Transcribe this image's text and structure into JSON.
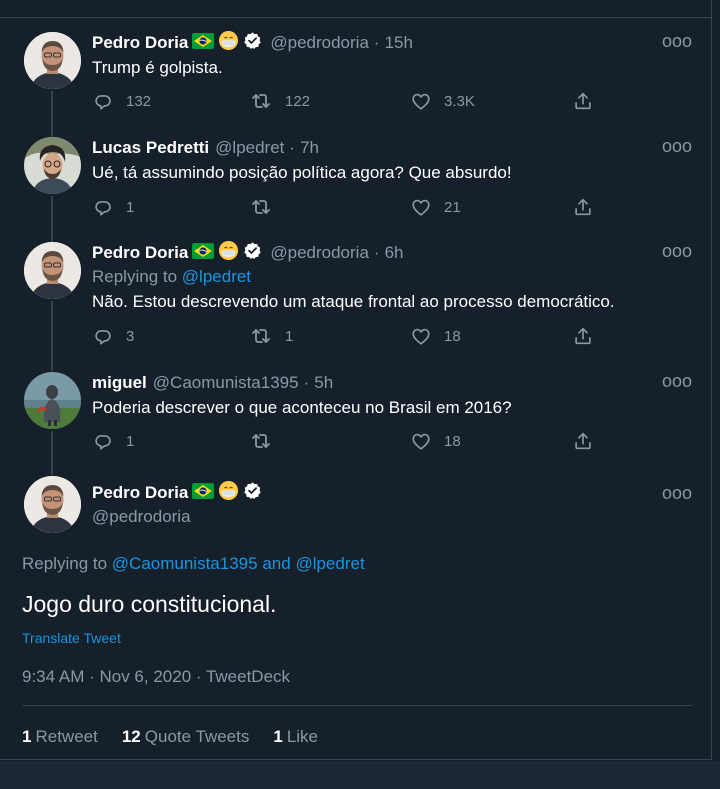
{
  "tweets": [
    {
      "name": "Pedro Doria",
      "handle": "@pedrodoria",
      "time": "15h",
      "text": "Trump é golpista.",
      "reply_count": "132",
      "retweet_count": "122",
      "like_count": "3.3K"
    },
    {
      "name": "Lucas Pedretti",
      "handle": "@lpedret",
      "time": "7h",
      "text": "Ué, tá assumindo posição política agora? Que absurdo!",
      "reply_count": "1",
      "retweet_count": "",
      "like_count": "21"
    },
    {
      "name": "Pedro Doria",
      "handle": "@pedrodoria",
      "time": "6h",
      "replying_label": "Replying to",
      "replying_to": "@lpedret",
      "text": "Não. Estou descrevendo um ataque frontal ao processo democrático.",
      "reply_count": "3",
      "retweet_count": "1",
      "like_count": "18"
    },
    {
      "name": "miguel",
      "handle": "@Caomunista1395",
      "time": "5h",
      "text": "Poderia descrever o que aconteceu no Brasil em 2016?",
      "reply_count": "1",
      "retweet_count": "",
      "like_count": "18"
    }
  ],
  "main_tweet": {
    "name": "Pedro Doria",
    "handle": "@pedrodoria",
    "replying_label": "Replying to",
    "replying_to_1": "@Caomunista1395",
    "replying_and": "and",
    "replying_to_2": "@lpedret",
    "text": "Jogo duro constitucional.",
    "translate": "Translate Tweet",
    "meta": "9:34 AM · Nov 6, 2020 · TweetDeck",
    "retweets_count": "1",
    "retweets_label": "Retweet",
    "quotes_count": "12",
    "quotes_label": "Quote Tweets",
    "likes_count": "1",
    "likes_label": "Like"
  },
  "separator": "·",
  "more_glyph": "ooo",
  "colors": {
    "background": "#15202b",
    "text_primary": "#ffffff",
    "text_secondary": "#8899a6",
    "link": "#1b95e0",
    "border": "#38444d",
    "verified": "#ffffff",
    "flag_green": "#009c3b",
    "flag_yellow": "#ffdf00",
    "flag_blue": "#002776"
  },
  "icons": {
    "reply": "reply-icon",
    "retweet": "retweet-icon",
    "like": "like-icon",
    "share": "share-icon",
    "verified": "verified-badge-icon",
    "flag": "brazil-flag-icon",
    "mask": "face-mask-emoji-icon",
    "more": "more-options-icon"
  }
}
